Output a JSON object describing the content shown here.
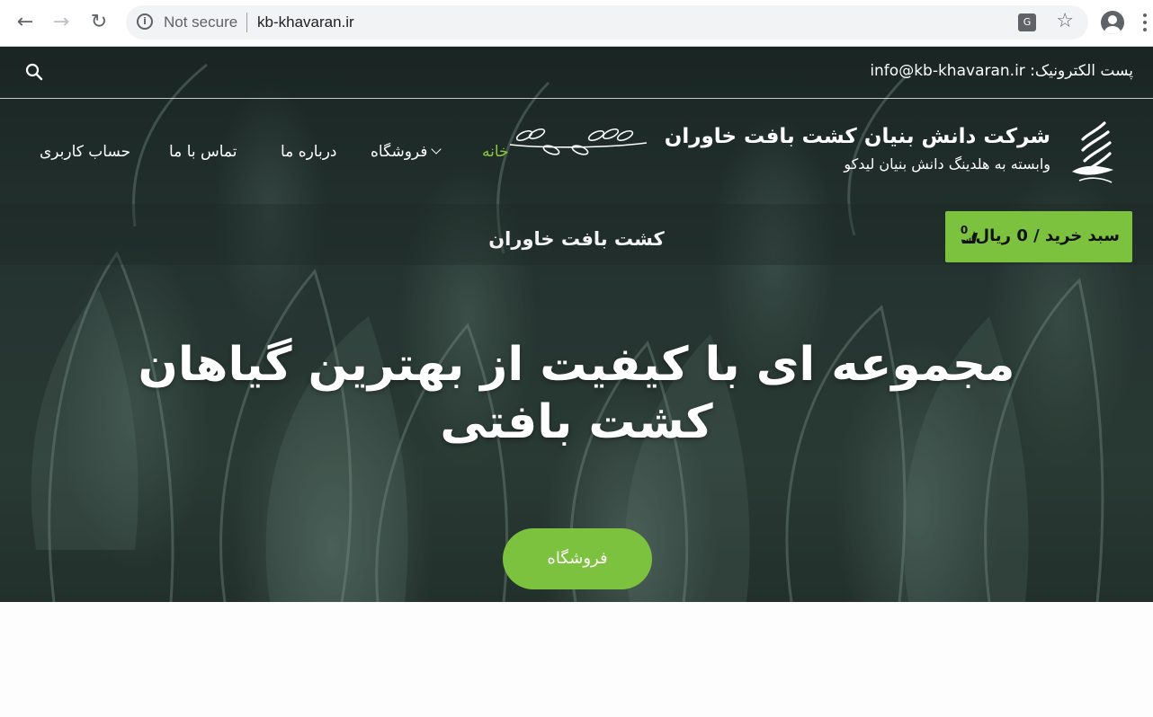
{
  "browser": {
    "security_label": "Not secure",
    "url": "kb-khavaran.ir",
    "back_icon": "arrow-left-icon",
    "forward_icon": "arrow-right-icon",
    "reload_icon": "reload-icon",
    "translate_icon": "translate-icon",
    "bookmark_icon": "star-icon",
    "profile_icon": "account-icon",
    "menu_icon": "kebab-menu-icon"
  },
  "topbar": {
    "email_text": "پست الکترونیک: info@kb-khavaran.ir",
    "search_icon": "search-icon"
  },
  "header": {
    "brand_title": "شرکت دانش بنیان کشت بافت خاوران",
    "brand_subtitle": "وابسته به هلدینگ دانش بنیان لیدکو",
    "menu": [
      {
        "label": "خانه",
        "active": true
      },
      {
        "label": "فروشگاه"
      },
      {
        "label": "درباره ما"
      },
      {
        "label": "تماس با ما"
      },
      {
        "label": "حساب کاربری"
      }
    ]
  },
  "band": {
    "title": "کشت بافت خاوران"
  },
  "cart": {
    "label": "سبد خرید / 0 ریال",
    "count": "0",
    "icon": "basket-icon"
  },
  "hero": {
    "headline": "مجموعه ای با کیفیت از بهترین گیاهان کشت بافتی",
    "button_label": "فروشگاه"
  },
  "colors": {
    "accent": "#7cc23f",
    "active_menu": "#8dc63f",
    "text_light": "#ffffff"
  }
}
